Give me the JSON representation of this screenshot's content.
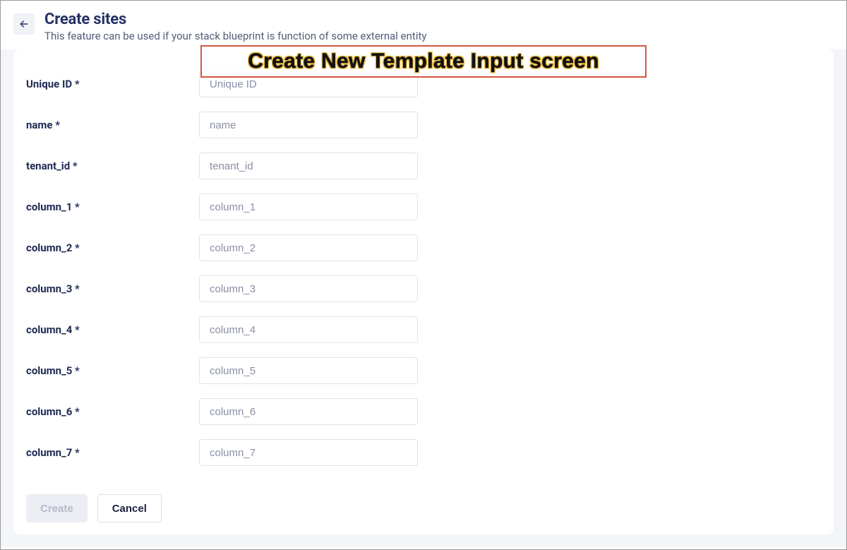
{
  "header": {
    "title": "Create sites",
    "subtitle": "This feature can be used if your stack blueprint is function of some external entity"
  },
  "overlay": {
    "caption": "Create New Template Input screen"
  },
  "form": {
    "fields": [
      {
        "label": "Unique ID *",
        "placeholder": "Unique ID"
      },
      {
        "label": "name *",
        "placeholder": "name"
      },
      {
        "label": "tenant_id *",
        "placeholder": "tenant_id"
      },
      {
        "label": "column_1 *",
        "placeholder": "column_1"
      },
      {
        "label": "column_2 *",
        "placeholder": "column_2"
      },
      {
        "label": "column_3 *",
        "placeholder": "column_3"
      },
      {
        "label": "column_4 *",
        "placeholder": "column_4"
      },
      {
        "label": "column_5 *",
        "placeholder": "column_5"
      },
      {
        "label": "column_6 *",
        "placeholder": "column_6"
      },
      {
        "label": "column_7 *",
        "placeholder": "column_7"
      }
    ]
  },
  "actions": {
    "create_label": "Create",
    "cancel_label": "Cancel"
  }
}
